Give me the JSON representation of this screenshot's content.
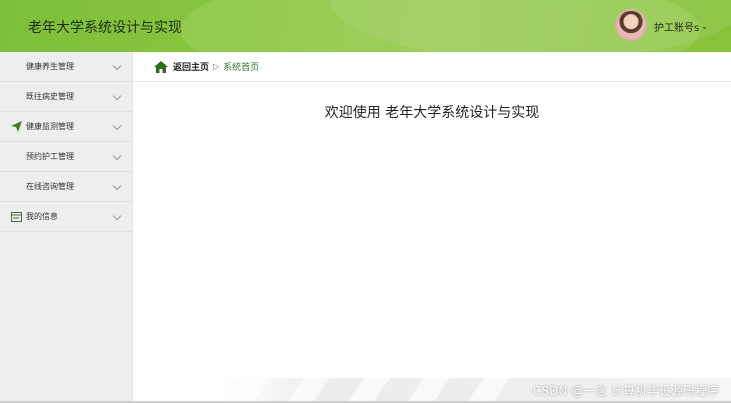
{
  "header": {
    "title": "老年大学系统设计与实现",
    "user_label": "护工账号s",
    "user_chevron": "⌄"
  },
  "sidebar": {
    "items": [
      {
        "label": "健康养生管理",
        "icon": "grid-icon"
      },
      {
        "label": "既往病史管理",
        "icon": "grid-icon"
      },
      {
        "label": "健康监测管理",
        "icon": "paper-plane-icon"
      },
      {
        "label": "预约护工管理",
        "icon": "grid-icon"
      },
      {
        "label": "在线咨询管理",
        "icon": "grid-icon"
      },
      {
        "label": "我的信息",
        "icon": "id-card-icon"
      }
    ]
  },
  "breadcrumb": {
    "home": "返回主页",
    "separator": "▷",
    "current": "系统首页"
  },
  "main": {
    "welcome": "欢迎使用 老年大学系统设计与实现"
  },
  "watermark": "CSDN @一念 计算机毕设源码程序",
  "colors": {
    "header_green": "#8cc63f",
    "icon_green": "#3d7a2a",
    "breadcrumb_active": "#2a7a32"
  }
}
